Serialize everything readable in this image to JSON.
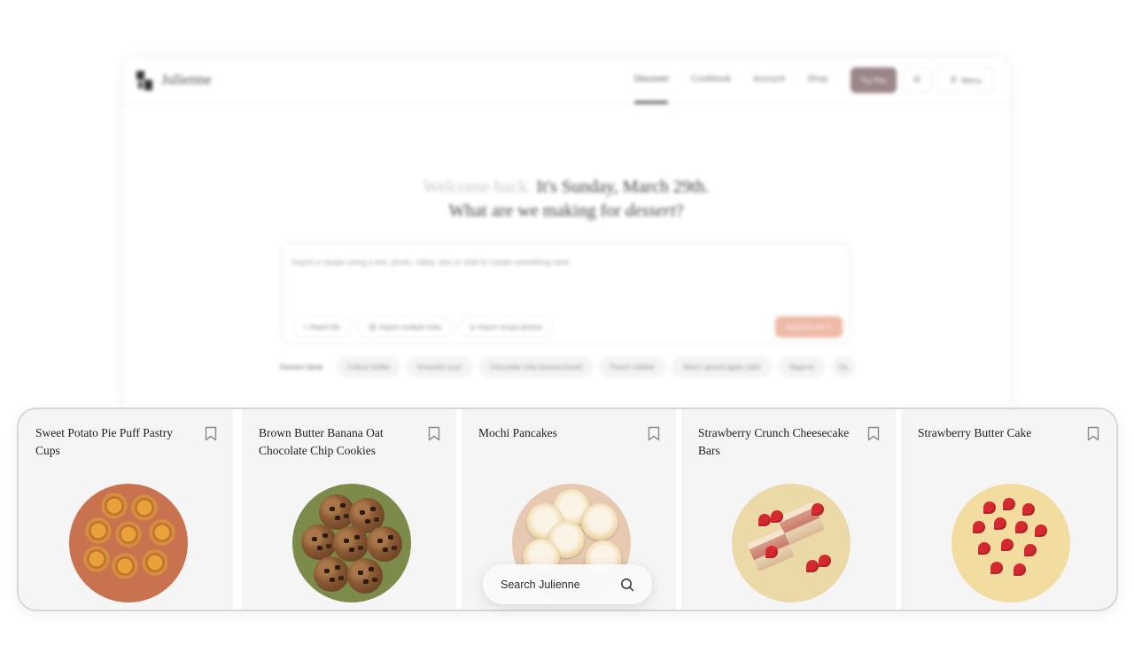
{
  "app": {
    "brand": "Julienne"
  },
  "nav": {
    "items": [
      {
        "label": "Discover",
        "active": true
      },
      {
        "label": "Cookbook",
        "active": false
      },
      {
        "label": "Account",
        "active": false
      },
      {
        "label": "Shop",
        "active": false
      }
    ],
    "try_pro": "Try Pro",
    "settings_icon": "gear-icon",
    "menu": "Menu"
  },
  "hero": {
    "greeting": "Welcome back.",
    "date": "It's Sunday, March 29th.",
    "question_prefix": "What are we making for",
    "question_emphasis": "dessert",
    "question_suffix": "?"
  },
  "composer": {
    "placeholder": "Import a recipe using a link, photo, video, text or chat to create something new!",
    "attach": "Attach file",
    "import_links": "Import multiple links",
    "import_photos": "Import recipe photos",
    "surprise": "Surprise me"
  },
  "ideas": {
    "label": "Dessert ideas",
    "items": [
      "Crème brûlée",
      "Amaretto sour",
      "Chocolate chip banana bread",
      "Peach cobbler",
      "Warm spiced apple cider",
      "Negroni",
      "Da"
    ]
  },
  "cards": [
    {
      "title": "Sweet Potato Pie Puff Pastry Cups"
    },
    {
      "title": "Brown Butter Banana Oat Chocolate Chip Cookies"
    },
    {
      "title": "Mochi Pancakes"
    },
    {
      "title": "Strawberry Crunch Cheesecake Bars"
    },
    {
      "title": "Strawberry Butter Cake"
    }
  ],
  "search": {
    "placeholder": "Search Julienne"
  },
  "colors": {
    "accent": "#9a8588",
    "surprise": "#eeb9a6",
    "card_bg": "#f5f5f5"
  }
}
